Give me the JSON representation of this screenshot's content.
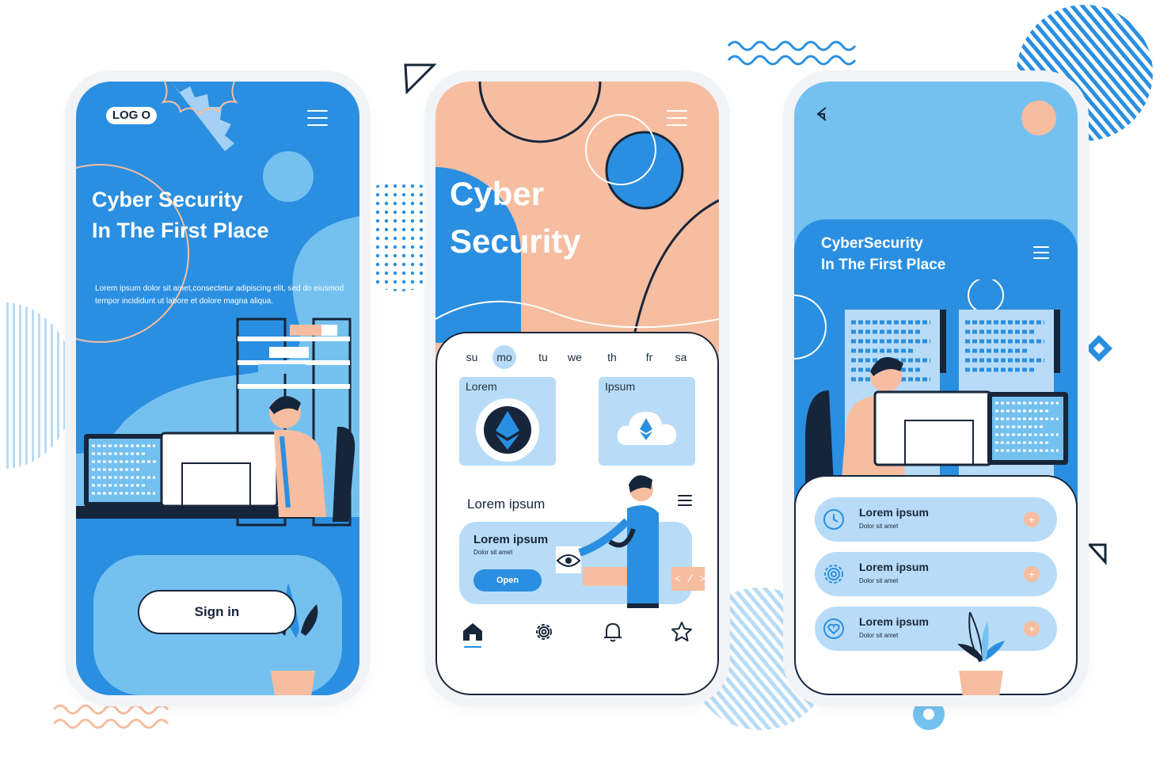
{
  "colors": {
    "accent_blue": "#2a8fe0",
    "light_blue": "#74c1f0",
    "pale_blue": "#b8dcf7",
    "peach": "#f6bda0",
    "dark": "#17253a"
  },
  "screen1": {
    "logo_text": "LOG O",
    "title_line1": "Cyber Security",
    "title_line2": "In The First Place",
    "body_line1": "Lorem ipsum dolor sit amet,consectetur adipiscing elit, sed do eiusmod",
    "body_line2": "tempor incididunt ut labore et dolore magna aliqua.",
    "sign_in_label": "Sign in"
  },
  "screen2": {
    "title_line1": "Cyber",
    "title_line2": "Security",
    "days": [
      "su",
      "mo",
      "tu",
      "we",
      "th",
      "fr",
      "sa"
    ],
    "selected_day": "mo",
    "tiles": [
      {
        "label": "Lorem",
        "icon": "ethereum-icon"
      },
      {
        "label": "Ipsum",
        "icon": "cloud-ethereum-icon"
      }
    ],
    "section_title": "Lorem ipsum",
    "card": {
      "title": "Lorem ipsum",
      "subtitle": "Dolor sit amet",
      "button_label": "Open",
      "code_text": "< / >"
    },
    "nav": [
      "home-icon",
      "settings-icon",
      "bell-icon",
      "star-icon"
    ]
  },
  "screen3": {
    "title_line1": "CyberSecurity",
    "title_line2": "In The First Place",
    "items": [
      {
        "title": "Lorem ipsum",
        "subtitle": "Dolor sit amet",
        "icon": "clock-icon",
        "action": "+"
      },
      {
        "title": "Lorem ipsum",
        "subtitle": "Dolor sit amet",
        "icon": "gear-icon",
        "action": "+"
      },
      {
        "title": "Lorem ipsum",
        "subtitle": "Dolor sit amet",
        "icon": "heart-icon",
        "action": "+"
      }
    ]
  }
}
